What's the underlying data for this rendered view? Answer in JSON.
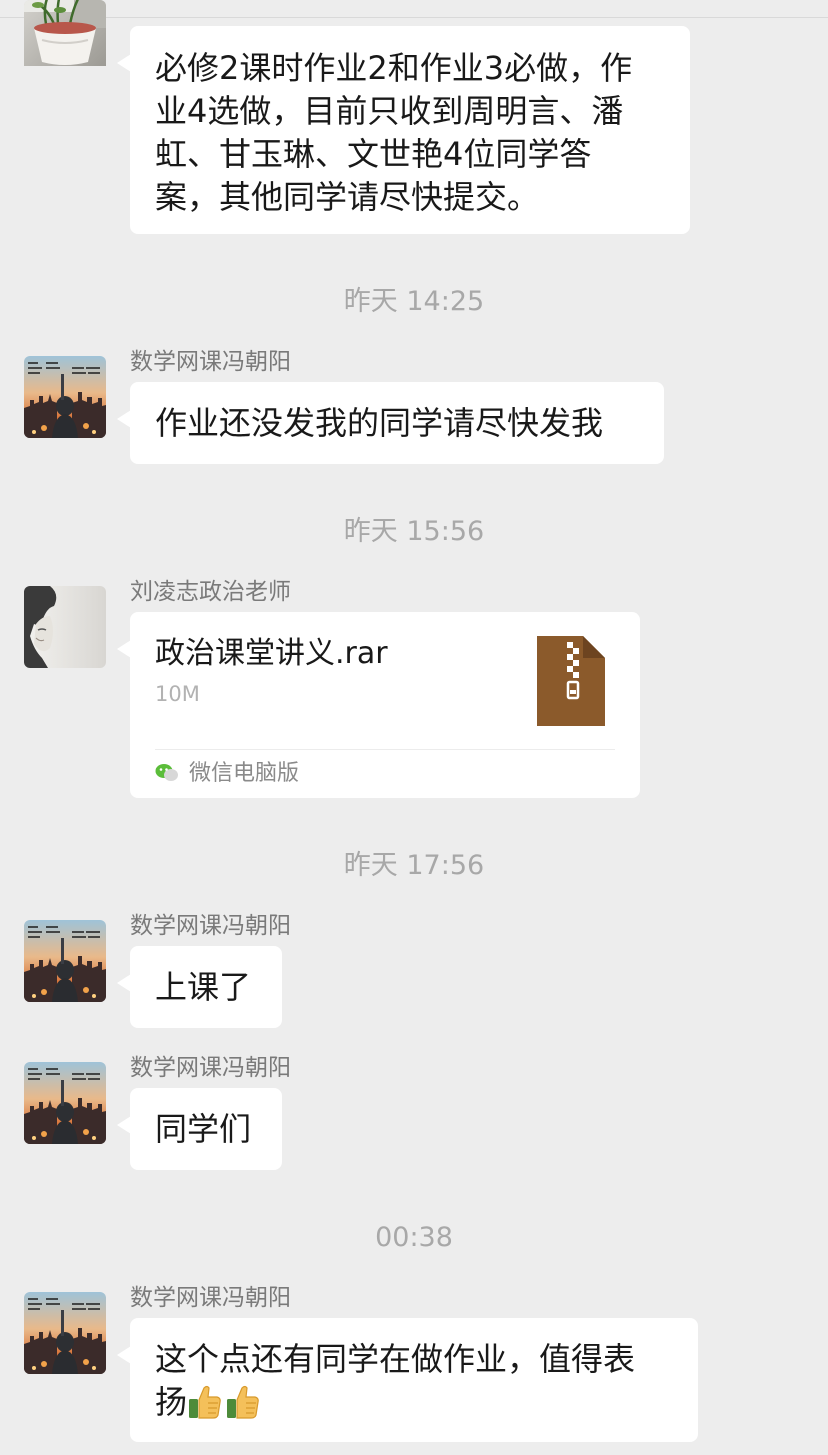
{
  "colors": {
    "background": "#ededed",
    "bubble": "#ffffff",
    "timestamp": "#a8a8a8",
    "sender": "#7a7a7a",
    "file_icon": "#8b5a2b",
    "wechat_green": "#07c160"
  },
  "messages": {
    "m1": {
      "text": "必修2课时作业2和作业3必做，作\n业4选做，目前只收到周明言、潘\n虹、甘玉琳、文世艳4位同学答\n案，其他同学请尽快提交。",
      "avatar": "potted-plant"
    },
    "t1": "昨天 14:25",
    "m2": {
      "sender": "数学网课冯朝阳",
      "text": "作业还没发我的同学请尽快发我",
      "avatar": "city-sunset"
    },
    "t2": "昨天 15:56",
    "m3": {
      "sender": "刘凌志政治老师",
      "avatar": "portrait",
      "file": {
        "name": "政治课堂讲义.rar",
        "size": "10M",
        "source": "微信电脑版",
        "icon": "zip-file-icon"
      }
    },
    "t3": "昨天 17:56",
    "m4": {
      "sender": "数学网课冯朝阳",
      "text": "上课了",
      "avatar": "city-sunset"
    },
    "m5": {
      "sender": "数学网课冯朝阳",
      "text": "同学们",
      "avatar": "city-sunset"
    },
    "t4": "00:38",
    "m6": {
      "sender": "数学网课冯朝阳",
      "text_line1": "这个点还有同学在做作业，值得表",
      "text_line2": "扬",
      "emoji": [
        "thumbs-up",
        "thumbs-up"
      ],
      "avatar": "city-sunset"
    }
  }
}
